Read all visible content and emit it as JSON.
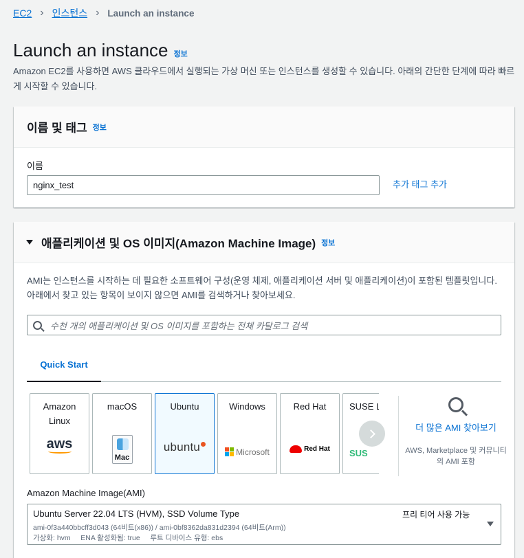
{
  "breadcrumb": {
    "items": [
      "EC2",
      "인스턴스"
    ],
    "current": "Launch an instance"
  },
  "page": {
    "title": "Launch an instance",
    "info": "정보",
    "description": "Amazon EC2를 사용하면 AWS 클라우드에서 실행되는 가상 머신 또는 인스턴스를 생성할 수 있습니다. 아래의 간단한 단계에 따라 빠르게 시작할 수 있습니다."
  },
  "name_panel": {
    "title": "이름 및 태그",
    "info": "정보",
    "field_label": "이름",
    "field_value": "nginx_test",
    "add_tags": "추가 태그 추가"
  },
  "ami_panel": {
    "title": "애플리케이션 및 OS 이미지(Amazon Machine Image)",
    "info": "정보",
    "description": "AMI는 인스턴스를 시작하는 데 필요한 소프트웨어 구성(운영 체제, 애플리케이션 서버 및 애플리케이션)이 포함된 템플릿입니다. 아래에서 찾고 있는 항목이 보이지 않으면 AMI를 검색하거나 찾아보세요.",
    "search_placeholder": "수천 개의 애플리케이션 및 OS 이미지를 포함하는 전체 카탈로그 검색",
    "tab_active": "Quick Start",
    "tiles": [
      {
        "name": "Amazon\nLinux",
        "logo_text": "aws",
        "selected": false
      },
      {
        "name": "macOS",
        "logo_text": "Mac",
        "selected": false
      },
      {
        "name": "Ubuntu",
        "logo_text": "ubuntu",
        "selected": true
      },
      {
        "name": "Windows",
        "logo_text": "Microsoft",
        "selected": false
      },
      {
        "name": "Red Hat",
        "logo_text": "Red Hat",
        "selected": false
      },
      {
        "name": "SUSE Li",
        "logo_text": "SUS",
        "selected": false
      }
    ],
    "more_amis": "더 많은 AMI 찾아보기",
    "more_amis_sub": "AWS, Marketplace 및 커뮤니티의 AMI 포함",
    "ami_label": "Amazon Machine Image(AMI)",
    "selected_ami": {
      "title": "Ubuntu Server 22.04 LTS (HVM), SSD Volume Type",
      "ids": "ami-0f3a440bbcff3d043 (64비트(x86)) / ami-0bf8362da831d2394 (64비트(Arm))",
      "attrs": "가상화: hvm     ENA 활성화됨: true     루트 디바이스 유형: ebs",
      "free_tier": "프리 티어 사용 가능"
    }
  },
  "colors": {
    "link": "#0972d3",
    "selected_tile_bg": "#f1faff",
    "aws_orange": "#ff9900",
    "ubuntu_orange": "#e95420",
    "redhat_red": "#ee0000",
    "suse_green": "#30ba78"
  }
}
